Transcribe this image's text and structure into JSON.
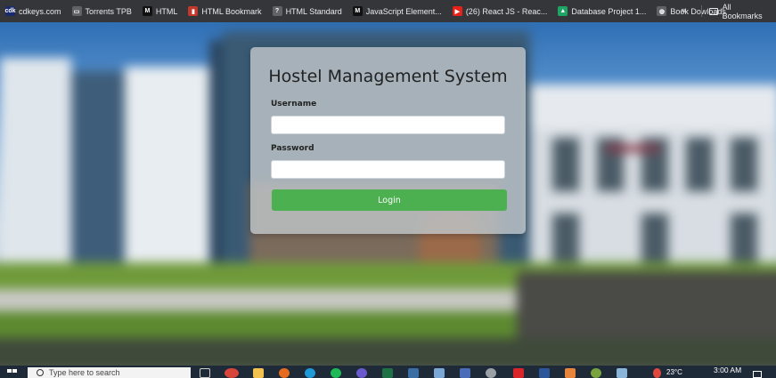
{
  "bookmarks": [
    {
      "label": "cdkeys.com",
      "icon": "cdkeys-icon",
      "color": "#1a2b6d",
      "glyph": "cdk"
    },
    {
      "label": "Torrents TPB",
      "icon": "monitor-icon",
      "color": "#5f6368",
      "glyph": "▭"
    },
    {
      "label": "HTML",
      "icon": "medium-icon",
      "color": "#111111",
      "glyph": "M"
    },
    {
      "label": "HTML Bookmark",
      "icon": "html-bookmark-icon",
      "color": "#c0392b",
      "glyph": "▮"
    },
    {
      "label": "HTML Standard",
      "icon": "question-icon",
      "color": "#5f6368",
      "glyph": "?"
    },
    {
      "label": "JavaScript Element...",
      "icon": "medium-icon",
      "color": "#111111",
      "glyph": "M"
    },
    {
      "label": "(26) React JS - Reac...",
      "icon": "youtube-icon",
      "color": "#e62117",
      "glyph": "▶"
    },
    {
      "label": "Database Project 1...",
      "icon": "google-drive-icon",
      "color": "#1fa463",
      "glyph": "▲"
    },
    {
      "label": "Book Dowloads",
      "icon": "globe-icon",
      "color": "#5f6368",
      "glyph": "◍"
    }
  ],
  "bookmarks_more": "»",
  "all_bookmarks": {
    "label": "All Bookmarks",
    "icon": "folder-icon"
  },
  "login": {
    "title": "Hostel Management System",
    "username_label": "Username",
    "username_value": "",
    "password_label": "Password",
    "password_value": "",
    "button_label": "Login",
    "button_color": "#4caf50"
  },
  "taskbar": {
    "search_placeholder": "Type here to search",
    "weather": "23°C",
    "time": "3:00 AM"
  }
}
